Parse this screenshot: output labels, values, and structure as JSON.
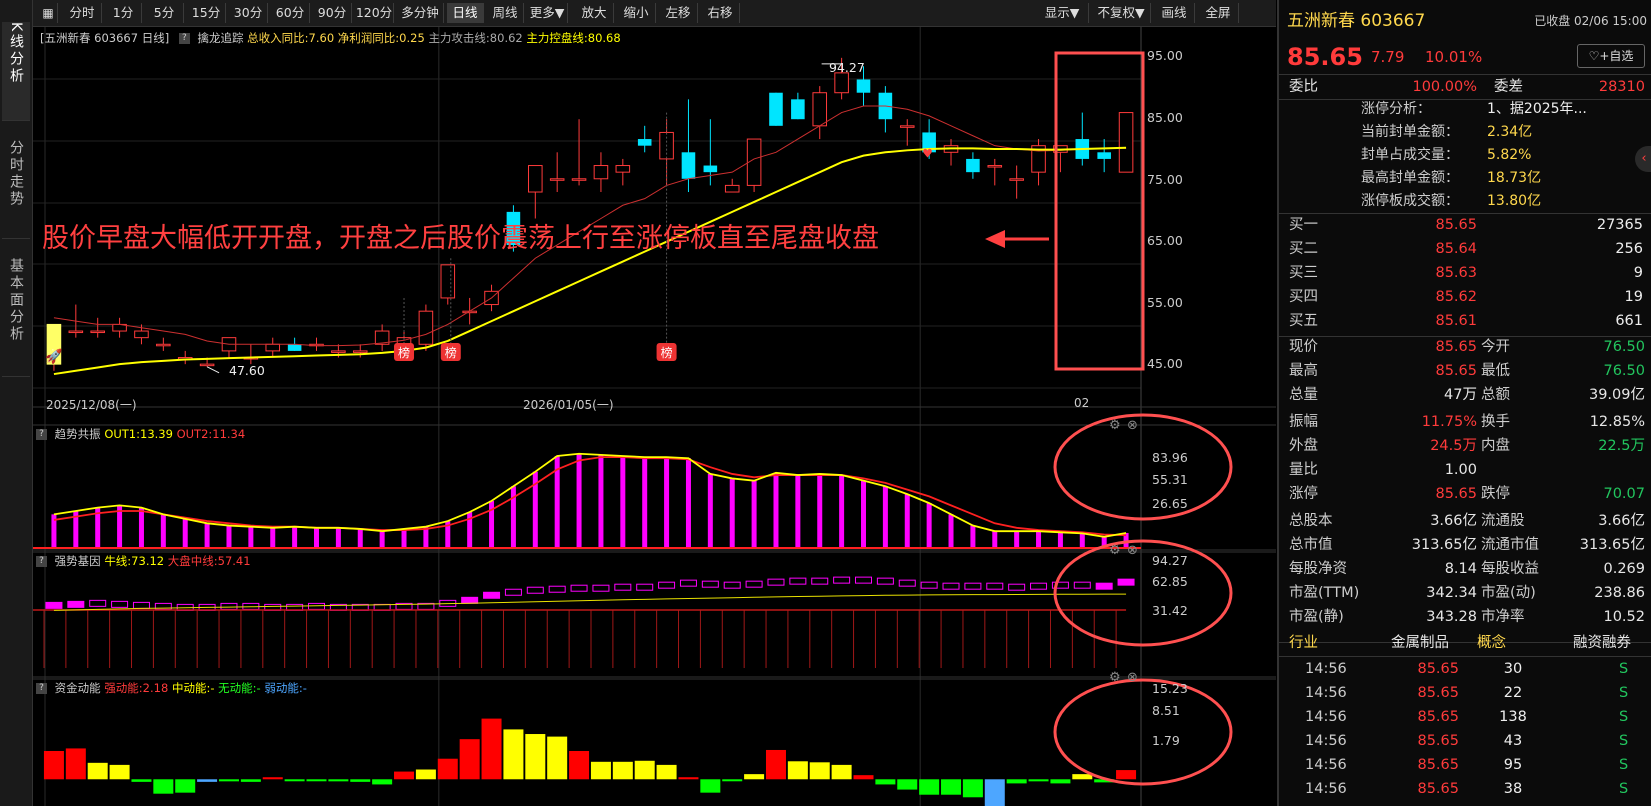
{
  "left_tabs": [
    {
      "label": "K线分析",
      "active": true
    },
    {
      "label": "分时走势",
      "active": false
    },
    {
      "label": "基本面分析",
      "active": false
    }
  ],
  "toolbar": {
    "icon_label": "▦",
    "periods": [
      "分时",
      "1分",
      "5分",
      "15分",
      "30分",
      "60分",
      "90分",
      "120分",
      "多分钟",
      "日线",
      "周线",
      "更多▼"
    ],
    "active_period": "日线",
    "tools": [
      "放大",
      "缩小",
      "左移",
      "右移"
    ],
    "right": [
      "显示▼",
      "不复权▼",
      "画线",
      "全屏"
    ]
  },
  "chart_info": {
    "stock_tag": "[五洲新春 603667 日线]",
    "indicator_name": "擒龙追踪",
    "revenue_yoy": "总收入同比:7.60",
    "profit_yoy": "净利润同比:0.25",
    "main_attack": "主力攻击线:80.62",
    "main_control": "主力控盘线:80.68"
  },
  "annotation": "股价早盘大幅低开开盘，开盘之后股价震荡上行至涨停板直至尾盘收盘",
  "price_labels": {
    "high": "94.27",
    "low": "47.60"
  },
  "bang_label": "榜",
  "date_axis": [
    "2025/12/08(一)",
    "2026/01/05(一)",
    "02"
  ],
  "price_axis": [
    "95.00",
    "85.00",
    "75.00",
    "65.00",
    "55.00",
    "45.00"
  ],
  "sub1": {
    "title": "趋势共振",
    "out1": "OUT1:13.39",
    "out2": "OUT2:11.34",
    "axis": [
      "83.96",
      "55.31",
      "26.65"
    ]
  },
  "sub2": {
    "title": "强势基因",
    "bull": "牛线:73.12",
    "market": "大盘中线:57.41",
    "axis": [
      "94.27",
      "62.85",
      "31.42"
    ]
  },
  "sub3": {
    "title": "资金动能",
    "strong": "强动能:2.18",
    "mid": "中动能:-",
    "none": "无动能:-",
    "weak": "弱动能:-",
    "axis": [
      "15.23",
      "8.51",
      "1.79"
    ]
  },
  "colors": {
    "up": "#ff3b3b",
    "down": "#00e5ff",
    "ma_yellow": "#ffff00",
    "magenta": "#ff00ff",
    "highlight": "#ff5050"
  },
  "chart_data": [
    {
      "type": "candlestick",
      "y_range": [
        45,
        95
      ],
      "x_labels": [
        "2025/12/08(一)",
        "2026/01/05(一)",
        "02"
      ],
      "ohlc": [
        [
          48,
          54,
          47,
          54
        ],
        [
          53,
          57,
          52,
          53
        ],
        [
          53,
          55,
          52,
          53
        ],
        [
          53,
          55,
          52,
          54
        ],
        [
          52,
          54,
          51,
          53
        ],
        [
          51,
          52,
          50,
          51
        ],
        [
          49,
          50,
          48,
          49
        ],
        [
          48,
          49,
          47.6,
          48
        ],
        [
          50,
          52,
          49,
          52
        ],
        [
          49,
          51,
          48,
          49
        ],
        [
          50,
          52,
          49,
          51
        ],
        [
          51,
          52,
          50,
          50
        ],
        [
          51,
          52,
          50,
          51
        ],
        [
          50,
          51,
          49,
          50
        ],
        [
          50,
          51,
          49,
          50
        ],
        [
          51,
          54,
          50,
          53
        ],
        [
          51,
          53,
          50,
          52
        ],
        [
          51,
          57,
          50,
          56
        ],
        [
          58,
          63,
          57,
          63
        ],
        [
          56,
          58,
          54,
          56
        ],
        [
          57,
          60,
          56,
          59
        ],
        [
          71,
          72,
          65,
          66
        ],
        [
          74,
          78,
          70,
          78
        ],
        [
          76,
          80,
          74,
          76
        ],
        [
          76,
          85,
          75,
          76
        ],
        [
          76,
          80,
          74,
          78
        ],
        [
          77,
          79,
          75,
          78
        ],
        [
          82,
          84,
          80,
          81
        ],
        [
          79,
          85,
          75,
          83
        ],
        [
          80,
          88,
          74,
          76
        ],
        [
          78,
          85,
          75,
          77
        ],
        [
          74,
          76,
          74,
          75
        ],
        [
          75,
          82,
          74,
          82
        ],
        [
          89,
          89,
          84,
          84
        ],
        [
          88,
          89,
          85,
          85
        ],
        [
          84,
          90,
          82,
          89
        ],
        [
          89,
          94.27,
          88,
          92
        ],
        [
          91,
          93,
          87,
          89
        ],
        [
          89,
          90,
          83,
          85
        ],
        [
          84,
          85,
          81,
          84
        ],
        [
          83,
          85,
          79,
          80
        ],
        [
          80,
          82,
          78,
          81
        ],
        [
          79,
          80,
          76,
          77
        ],
        [
          78,
          79,
          75,
          78
        ],
        [
          76,
          78,
          73,
          76
        ],
        [
          77,
          82,
          75,
          81
        ],
        [
          80,
          81,
          77,
          81
        ],
        [
          82,
          86,
          78,
          79
        ],
        [
          80,
          82,
          77,
          79
        ],
        [
          77,
          86,
          77,
          86
        ]
      ],
      "ma_attack": [
        55,
        54.5,
        54,
        54,
        53.5,
        53,
        52.5,
        51.5,
        51,
        51,
        51,
        51,
        50.8,
        50.8,
        50.9,
        51.2,
        51.6,
        52.5,
        54,
        56,
        58,
        61,
        64,
        66,
        68,
        70,
        72,
        73,
        75,
        76,
        76.5,
        77,
        79,
        80,
        82,
        84,
        86,
        87,
        87,
        86.5,
        85.5,
        84,
        82.5,
        81,
        80.5,
        80.2,
        80.3,
        80.5,
        80.6,
        80.62
      ],
      "ma_control": [
        46.5,
        47,
        47.5,
        48,
        48.3,
        48.5,
        48.7,
        48.8,
        48.9,
        49,
        49.1,
        49.2,
        49.3,
        49.4,
        49.5,
        49.7,
        50,
        50.5,
        51.5,
        53,
        54.5,
        56,
        57.5,
        59,
        60.5,
        62,
        63.5,
        65,
        66.5,
        68,
        69.5,
        71,
        72.5,
        74,
        75.5,
        77,
        78.5,
        79.5,
        80,
        80.3,
        80.5,
        80.6,
        80.6,
        80.5,
        80.5,
        80.4,
        80.4,
        80.5,
        80.6,
        80.68
      ]
    },
    {
      "type": "bar",
      "name": "趋势共振",
      "y_range": [
        0,
        90
      ],
      "values": [
        30,
        33,
        36,
        38,
        36,
        30,
        26,
        22,
        20,
        19,
        18,
        19,
        18,
        18,
        17,
        15,
        17,
        19,
        24,
        32,
        42,
        55,
        68,
        82,
        84,
        83,
        82,
        81,
        81,
        80,
        66,
        62,
        60,
        67,
        65,
        66,
        65,
        60,
        55,
        48,
        40,
        30,
        20,
        15,
        15,
        15,
        14,
        13,
        10,
        13.39
      ],
      "line_yellow": [
        30,
        33,
        36,
        38,
        36,
        30,
        26,
        22,
        20,
        19,
        18,
        19,
        18,
        18,
        17,
        15,
        17,
        19,
        24,
        32,
        42,
        55,
        68,
        82,
        84,
        83,
        82,
        81,
        81,
        80,
        66,
        62,
        60,
        67,
        65,
        66,
        65,
        60,
        55,
        48,
        40,
        30,
        20,
        15,
        15,
        15,
        14,
        13,
        10,
        13.39
      ],
      "line_red": [
        25,
        28,
        31,
        33,
        33,
        30,
        27,
        24,
        22,
        20,
        19,
        19,
        18,
        18,
        17,
        16,
        16,
        17,
        20,
        26,
        34,
        45,
        57,
        70,
        78,
        81,
        81,
        80,
        80,
        79,
        72,
        66,
        63,
        65,
        65,
        65,
        65,
        62,
        58,
        52,
        46,
        38,
        30,
        22,
        18,
        16,
        15,
        14,
        12,
        11.34
      ]
    },
    {
      "type": "bar",
      "name": "强势基因",
      "y_range": [
        0,
        100
      ],
      "values": [
        62,
        63,
        64,
        63,
        62,
        61,
        60,
        60,
        61,
        61,
        60,
        60,
        61,
        60,
        60,
        60,
        61,
        61,
        64,
        67,
        72,
        75,
        77,
        78,
        79,
        79,
        80,
        80,
        82,
        84,
        83,
        82,
        83,
        85,
        86,
        86,
        87,
        87,
        86,
        84,
        82,
        81,
        81,
        81,
        80,
        81,
        82,
        82,
        81,
        85
      ],
      "bull_line": [
        57,
        57.5,
        58,
        58.5,
        59,
        59.3,
        59.6,
        60,
        60.3,
        60.6,
        61,
        61.3,
        61.6,
        62,
        62.3,
        62.6,
        63,
        63.3,
        63.7,
        64.1,
        64.6,
        65.1,
        65.6,
        66.1,
        66.6,
        67.1,
        67.6,
        68,
        68.4,
        68.8,
        69.2,
        69.6,
        70,
        70.4,
        70.8,
        71.1,
        71.4,
        71.7,
        72,
        72.2,
        72.4,
        72.5,
        72.6,
        72.7,
        72.8,
        72.9,
        73,
        73.05,
        73.1,
        73.12
      ],
      "market_line": 57.41
    },
    {
      "type": "bar",
      "name": "资金动能",
      "y_range": [
        -5,
        16
      ],
      "values": [
        5.5,
        6,
        3.2,
        2.8,
        -0.5,
        -2.8,
        -2.6,
        -0.5,
        -0.4,
        -0.5,
        0.4,
        -0.2,
        -0.3,
        -0.4,
        -0.5,
        -1,
        1.5,
        1.9,
        4,
        7.8,
        11.8,
        9.7,
        8.8,
        8.3,
        5.5,
        3.4,
        3.4,
        3.6,
        2.8,
        0.4,
        -2.6,
        -0.3,
        1,
        5.7,
        3.5,
        3.3,
        2.8,
        0.8,
        -1,
        -2,
        -3,
        -3,
        -3.5,
        -5.4,
        -0.8,
        -0.4,
        -0.8,
        1,
        -0.6,
        1.79
      ],
      "colors_legend": {
        "strong": "#ff0000",
        "mid": "#ffff00",
        "none": "#00ff00",
        "weak": "#4da6ff"
      }
    }
  ],
  "quote": {
    "name": "五洲新春",
    "code": "603667",
    "status": "已收盘 02/06 15:00",
    "price": "85.65",
    "change": "7.79",
    "pct": "10.01%",
    "watch_btn": "♡+自选",
    "weibi_label": "委比",
    "weibi": "100.00%",
    "weicha_label": "委差",
    "weicha": "28310",
    "limit_rows": [
      {
        "label": "涨停分析：",
        "value": "1、据2025年..."
      },
      {
        "label": "当前封单金额：",
        "value": "2.34亿"
      },
      {
        "label": "封单占成交量：",
        "value": "5.82%"
      },
      {
        "label": "最高封单金额：",
        "value": "18.73亿"
      },
      {
        "label": "涨停板成交额：",
        "value": "13.80亿"
      }
    ],
    "bids": [
      {
        "label": "买一",
        "price": "85.65",
        "vol": "27365"
      },
      {
        "label": "买二",
        "price": "85.64",
        "vol": "256"
      },
      {
        "label": "买三",
        "price": "85.63",
        "vol": "9"
      },
      {
        "label": "买四",
        "price": "85.62",
        "vol": "19"
      },
      {
        "label": "买五",
        "price": "85.61",
        "vol": "661"
      }
    ],
    "stats": [
      [
        {
          "l": "现价",
          "v": "85.65",
          "c": "red"
        },
        {
          "l": "今开",
          "v": "76.50",
          "c": "green"
        }
      ],
      [
        {
          "l": "最高",
          "v": "85.65",
          "c": "red"
        },
        {
          "l": "最低",
          "v": "76.50",
          "c": "green"
        }
      ],
      [
        {
          "l": "总量",
          "v": "47万",
          "c": "white"
        },
        {
          "l": "总额",
          "v": "39.09亿",
          "c": "white"
        }
      ],
      [
        {
          "l": "振幅",
          "v": "11.75%",
          "c": "red"
        },
        {
          "l": "换手",
          "v": "12.85%",
          "c": "white"
        }
      ],
      [
        {
          "l": "外盘",
          "v": "24.5万",
          "c": "red"
        },
        {
          "l": "内盘",
          "v": "22.5万",
          "c": "green"
        }
      ],
      [
        {
          "l": "量比",
          "v": "1.00",
          "c": "white"
        },
        {
          "l": "",
          "v": "",
          "c": "white"
        }
      ],
      [
        {
          "l": "涨停",
          "v": "85.65",
          "c": "red"
        },
        {
          "l": "跌停",
          "v": "70.07",
          "c": "green"
        }
      ],
      [
        {
          "l": "总股本",
          "v": "3.66亿",
          "c": "white"
        },
        {
          "l": "流通股",
          "v": "3.66亿",
          "c": "white"
        }
      ],
      [
        {
          "l": "总市值",
          "v": "313.65亿",
          "c": "white"
        },
        {
          "l": "流通市值",
          "v": "313.65亿",
          "c": "white"
        }
      ],
      [
        {
          "l": "每股净资",
          "v": "8.14",
          "c": "white"
        },
        {
          "l": "每股收益",
          "v": "0.269",
          "c": "white"
        }
      ],
      [
        {
          "l": "市盈(TTM)",
          "v": "342.34",
          "c": "white"
        },
        {
          "l": "市盈(动)",
          "v": "238.86",
          "c": "white"
        }
      ],
      [
        {
          "l": "市盈(静)",
          "v": "343.28",
          "c": "white"
        },
        {
          "l": "市净率",
          "v": "10.52",
          "c": "white"
        }
      ]
    ],
    "tags": {
      "industry_label": "行业",
      "industry": "金属制品",
      "concept": "概念",
      "margin": "融资融券"
    },
    "trades": [
      {
        "t": "14:56",
        "p": "85.65",
        "v": "30",
        "d": "S"
      },
      {
        "t": "14:56",
        "p": "85.65",
        "v": "22",
        "d": "S"
      },
      {
        "t": "14:56",
        "p": "85.65",
        "v": "138",
        "d": "S"
      },
      {
        "t": "14:56",
        "p": "85.65",
        "v": "43",
        "d": "S"
      },
      {
        "t": "14:56",
        "p": "85.65",
        "v": "95",
        "d": "S"
      },
      {
        "t": "14:56",
        "p": "85.65",
        "v": "38",
        "d": "S"
      }
    ]
  }
}
